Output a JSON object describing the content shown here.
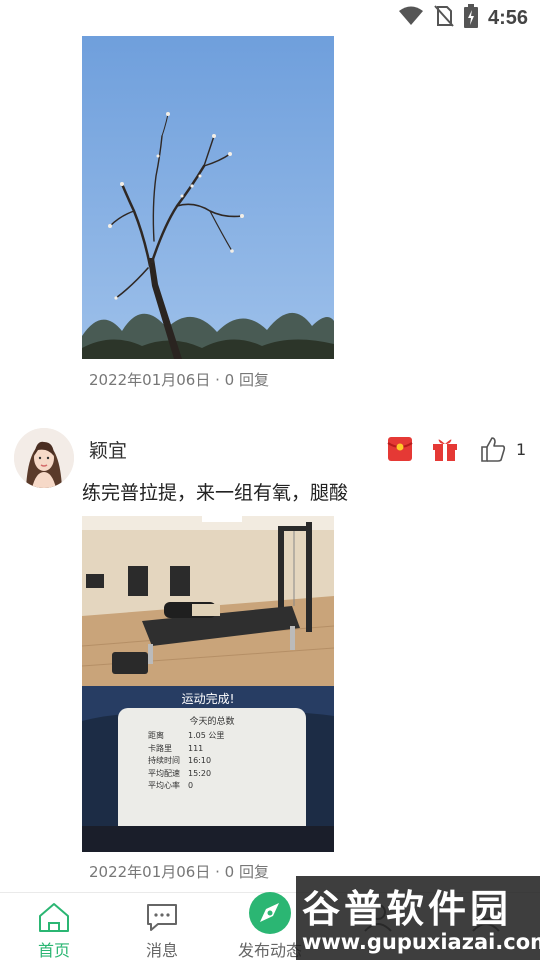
{
  "status_bar": {
    "time": "4:56",
    "icons": [
      "wifi-icon",
      "no-sim-icon",
      "battery-charging-icon"
    ]
  },
  "feed": {
    "posts": [
      {
        "image": "tree-branch-sky-photo",
        "date": "2022年01月06日",
        "replies": "· 0 回复"
      },
      {
        "username": "颖宜",
        "text": "练完普拉提，来一组有氧，腿酸",
        "image": "pilates-studio-and-workout-summary-photo",
        "workout_screen": {
          "title": "运动完成!",
          "subtitle": "今天的总数",
          "rows": [
            {
              "label": "距离",
              "value": "1.05 公里"
            },
            {
              "label": "卡路里",
              "value": "111"
            },
            {
              "label": "持续时间",
              "value": "16:10"
            },
            {
              "label": "平均配速",
              "value": "15:20"
            },
            {
              "label": "平均心率",
              "value": "0"
            }
          ]
        },
        "date": "2022年01月06日",
        "replies": "· 0 回复",
        "like_count": "1",
        "actions": [
          "red-envelope-icon",
          "gift-icon",
          "thumbs-up-icon"
        ]
      }
    ]
  },
  "bottom_nav": {
    "items": [
      {
        "label": "首页",
        "icon": "home-icon",
        "active": true
      },
      {
        "label": "消息",
        "icon": "message-icon",
        "active": false
      },
      {
        "label": "发布动态",
        "icon": "compass-icon",
        "active": false
      },
      {
        "label": "",
        "icon": "user-icon",
        "active": false
      },
      {
        "label": "",
        "icon": "mine-icon",
        "active": false
      }
    ]
  },
  "watermark": {
    "title": "谷普软件园",
    "url": "www.gupuxiazai.com"
  },
  "colors": {
    "accent": "#2bb673",
    "sky": "#7fa8de",
    "red_envelope": "#e53935",
    "gift": "#e53935"
  }
}
